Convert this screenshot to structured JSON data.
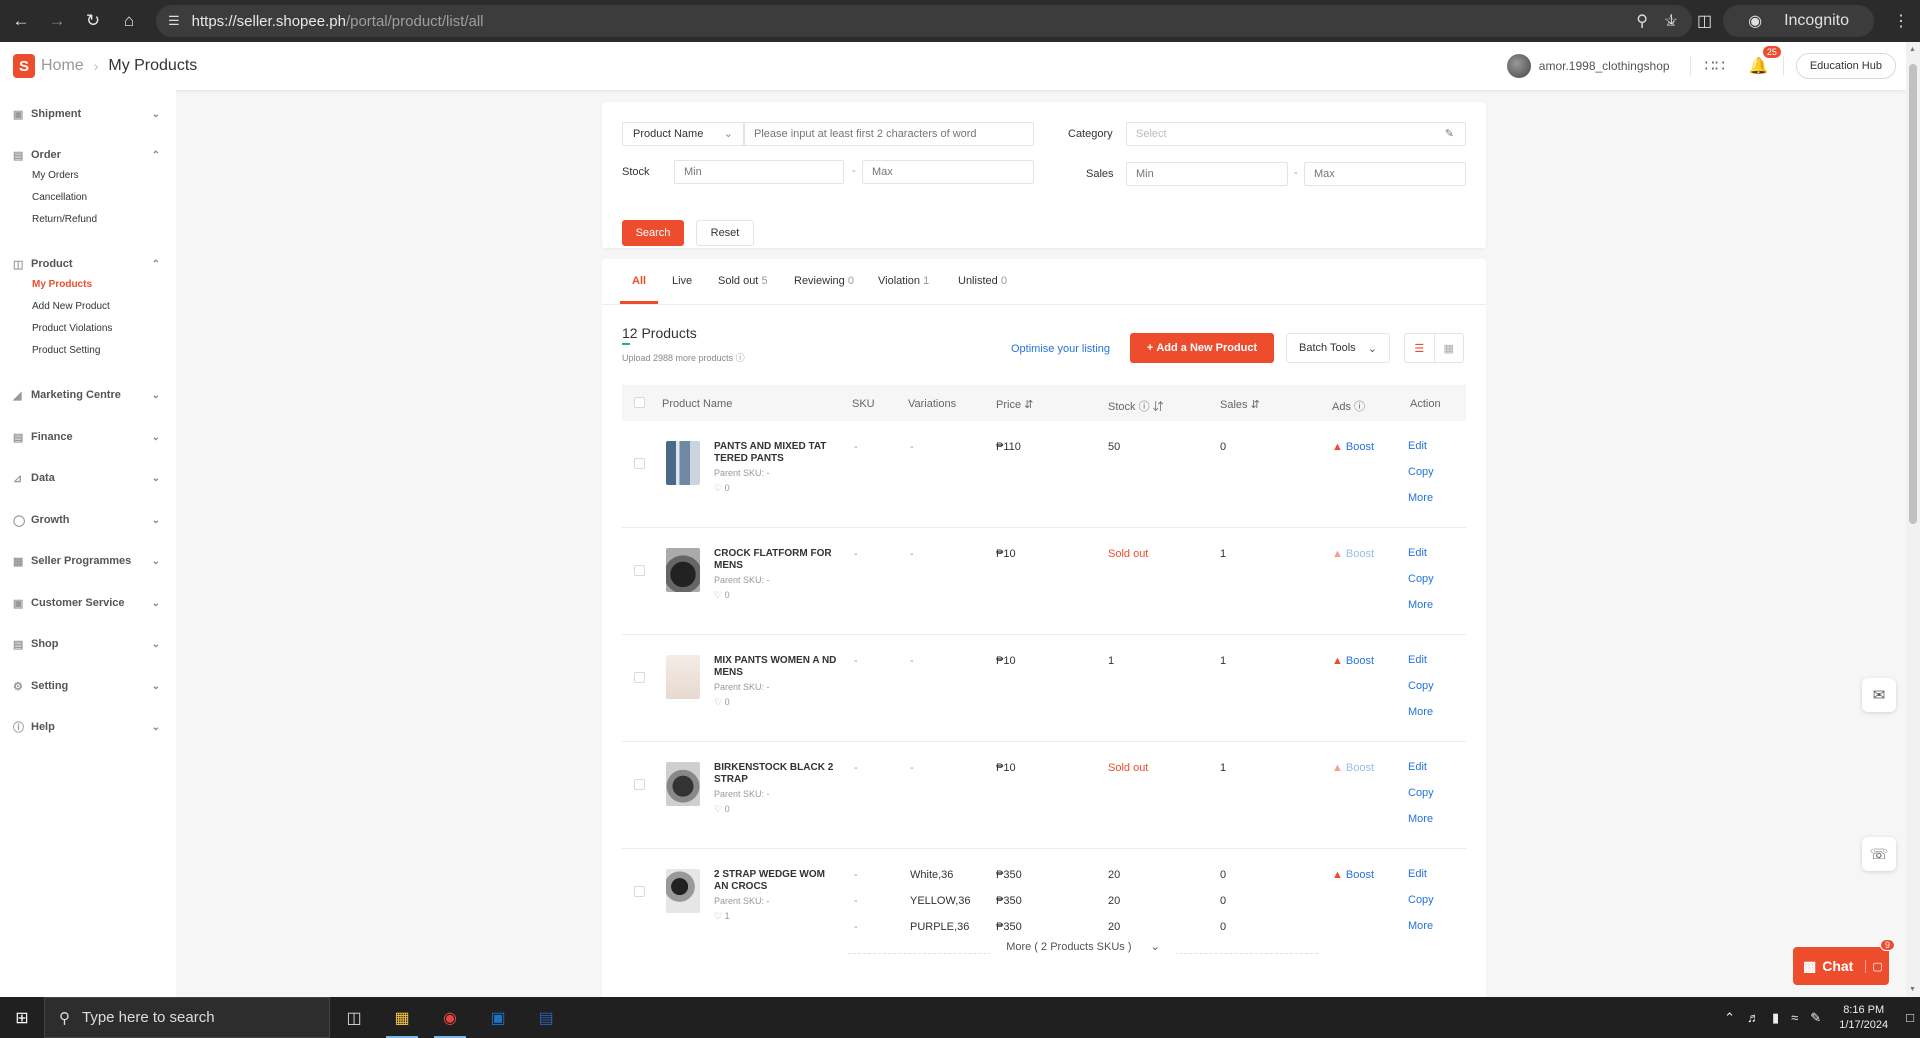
{
  "browser": {
    "url_main": "https://seller.shopee.ph",
    "url_path": "/portal/product/list/all",
    "incognito_label": "Incognito"
  },
  "header": {
    "breadcrumb_home": "Home",
    "breadcrumb_current": "My Products",
    "shop_name": "amor.1998_clothingshop",
    "notif_count": "25",
    "edu_hub": "Education Hub"
  },
  "sidebar": {
    "shipment": "Shipment",
    "order": "Order",
    "order_items": [
      "My Orders",
      "Cancellation",
      "Return/Refund"
    ],
    "product": "Product",
    "product_items": [
      "My Products",
      "Add New Product",
      "Product Violations",
      "Product Setting"
    ],
    "marketing": "Marketing Centre",
    "finance": "Finance",
    "data": "Data",
    "growth": "Growth",
    "seller_programmes": "Seller Programmes",
    "customer_service": "Customer Service",
    "shop": "Shop",
    "setting": "Setting",
    "help": "Help"
  },
  "filter": {
    "select_value": "Product Name",
    "name_placeholder": "Please input at least first 2 characters of word",
    "category_label": "Category",
    "category_placeholder": "Select",
    "stock_label": "Stock",
    "sales_label": "Sales",
    "min": "Min",
    "max": "Max",
    "dash": "-",
    "search_btn": "Search",
    "reset_btn": "Reset"
  },
  "tabs": {
    "all": "All",
    "live": "Live",
    "soldout": "Sold out",
    "soldout_count": "5",
    "reviewing": "Reviewing",
    "reviewing_count": "0",
    "violation": "Violation",
    "violation_count": "1",
    "unlisted": "Unlisted",
    "unlisted_count": "0"
  },
  "list": {
    "count_title": "12 Products",
    "upload_more": "Upload 2988 more products",
    "optimise": "Optimise your listing",
    "add_btn": "Add a New Product",
    "batch_btn": "Batch Tools",
    "more_skus": "More ( 2 Products SKUs )"
  },
  "table": {
    "headers": {
      "name": "Product Name",
      "sku": "SKU",
      "variations": "Variations",
      "price": "Price",
      "stock": "Stock",
      "sales": "Sales",
      "ads": "Ads",
      "action": "Action"
    },
    "parent_sku": "Parent SKU: -",
    "actions": {
      "edit": "Edit",
      "copy": "Copy",
      "more": "More"
    },
    "boost": "Boost",
    "rows": [
      {
        "name": "PANTS AND MIXED TAT TERED PANTS",
        "likes": "0",
        "sku": "-",
        "variation": "-",
        "price": "₱110",
        "stock": "50",
        "sales": "0"
      },
      {
        "name": "CROCK FLATFORM FOR MENS",
        "likes": "0",
        "sku": "-",
        "variation": "-",
        "price": "₱10",
        "stock": "Sold out",
        "sales": "1"
      },
      {
        "name": "MIX PANTS WOMEN A ND MENS",
        "likes": "0",
        "sku": "-",
        "variation": "-",
        "price": "₱10",
        "stock": "1",
        "sales": "1"
      },
      {
        "name": "BIRKENSTOCK BLACK 2 STRAP",
        "likes": "0",
        "sku": "-",
        "variation": "-",
        "price": "₱10",
        "stock": "Sold out",
        "sales": "1"
      },
      {
        "name": "2 STRAP WEDGE WOM AN CROCS",
        "likes": "1",
        "variants": [
          {
            "sku": "-",
            "variation": "White,36",
            "price": "₱350",
            "stock": "20",
            "sales": "0"
          },
          {
            "sku": "-",
            "variation": "YELLOW,36",
            "price": "₱350",
            "stock": "20",
            "sales": "0"
          },
          {
            "sku": "-",
            "variation": "PURPLE,36",
            "price": "₱350",
            "stock": "20",
            "sales": "0"
          }
        ]
      }
    ]
  },
  "chat": {
    "label": "Chat",
    "badge": "9"
  },
  "taskbar": {
    "search_placeholder": "Type here to search",
    "time": "8:16 PM",
    "date": "1/17/2024"
  }
}
